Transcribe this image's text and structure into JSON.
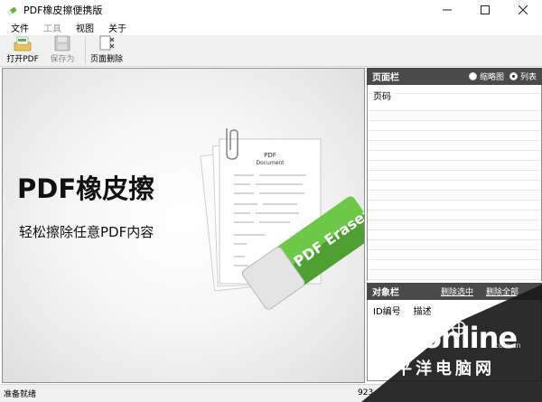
{
  "window": {
    "title": "PDF橡皮擦便携版",
    "controls": [
      "minimize",
      "maximize",
      "close"
    ]
  },
  "menu": {
    "items": [
      {
        "label": "文件",
        "enabled": true
      },
      {
        "label": "工具",
        "enabled": false
      },
      {
        "label": "视图",
        "enabled": true
      },
      {
        "label": "关于",
        "enabled": true
      }
    ]
  },
  "toolbar": {
    "open_label": "打开PDF",
    "save_label": "保存为",
    "delete_label": "页面删除",
    "icons": [
      "open-pdf-icon",
      "save-icon",
      "page-delete-icon"
    ]
  },
  "splash": {
    "title": "PDF橡皮擦",
    "subtitle": "轻松擦除任意PDF内容",
    "doc_heading": "PDF",
    "doc_subheading": "Document",
    "eraser_text": "PDF Eraser",
    "accent_color": "#5cb83c"
  },
  "page_panel": {
    "title": "页面栏",
    "view_thumbnail": "缩略图",
    "view_list": "列表",
    "selected_view": "list",
    "column_header": "页码"
  },
  "object_panel": {
    "title": "对象栏",
    "delete_selected": "删除选中",
    "delete_all": "删除全部",
    "columns": [
      "ID编号",
      "描述"
    ]
  },
  "status": {
    "text": "准备就绪",
    "right_text": "923"
  },
  "watermark": {
    "brand": "PConline",
    "domain": ".com.cn",
    "cn_brand": "太平洋电脑网"
  }
}
